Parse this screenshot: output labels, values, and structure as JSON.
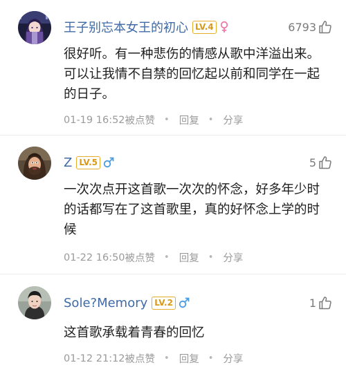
{
  "comments": [
    {
      "username": "王子别忘本女王的初心",
      "level": "LV.4",
      "gender": "female",
      "likes": "6793",
      "text": "很好听。有一种悲伤的情感从歌中洋溢出来。可以让我情不自禁的回忆起以前和同学在一起的日子。",
      "time": "01-19 16:52",
      "like_label": "被点赞",
      "reply_label": "回复",
      "share_label": "分享",
      "dot": "•"
    },
    {
      "username": "Z",
      "level": "LV.5",
      "gender": "male",
      "likes": "5",
      "text": "一次次点开这首歌一次次的怀念，好多年少时的话都写在了这首歌里，真的好怀念上学的时候",
      "time": "01-22 16:50",
      "like_label": "被点赞",
      "reply_label": "回复",
      "share_label": "分享",
      "dot": "•"
    },
    {
      "username": "Sole?Memory",
      "level": "LV.2",
      "gender": "male",
      "likes": "1",
      "text": "这首歌承载着青春的回忆",
      "time": "01-12 21:12",
      "like_label": "被点赞",
      "reply_label": "回复",
      "share_label": "分享",
      "dot": "•"
    }
  ],
  "colors": {
    "username": "#3f6aa7",
    "level_badge": "#e6ad2a",
    "female_icon": "#f07aa8",
    "male_icon": "#4a9be0",
    "meta_text": "#9a9a9a",
    "body_text": "#1f1f1f"
  },
  "icons": {
    "like": "thumbs-up-icon",
    "female": "female-icon",
    "male": "male-icon"
  }
}
